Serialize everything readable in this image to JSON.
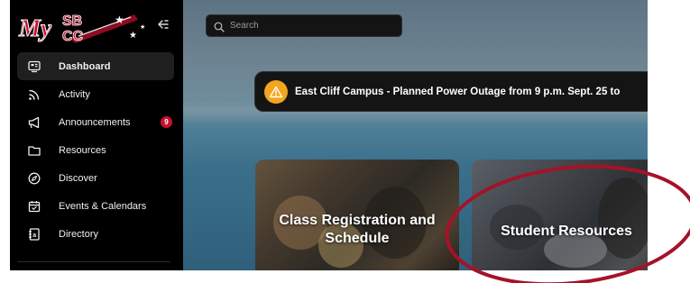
{
  "app": {
    "logo": {
      "line1": "My",
      "line2": "SB",
      "line3": "CC",
      "colors": {
        "text": "#c8102e",
        "outline": "#ffffff"
      }
    },
    "collapse_icon": "collapse-sidebar-icon"
  },
  "sidebar": {
    "items": [
      {
        "label": "Dashboard",
        "icon": "dashboard-icon",
        "active": true
      },
      {
        "label": "Activity",
        "icon": "activity-icon"
      },
      {
        "label": "Announcements",
        "icon": "megaphone-icon",
        "badge": "9"
      },
      {
        "label": "Resources",
        "icon": "folder-icon"
      },
      {
        "label": "Discover",
        "icon": "compass-icon"
      },
      {
        "label": "Events & Calendars",
        "icon": "calendar-icon"
      },
      {
        "label": "Directory",
        "icon": "directory-icon"
      }
    ]
  },
  "search": {
    "placeholder": "Search",
    "value": ""
  },
  "alert": {
    "text": "East Cliff Campus - Planned Power Outage from 9 p.m. Sept. 25 to",
    "icon": "warning-icon"
  },
  "cards": [
    {
      "title": "Class Registration and Schedule"
    },
    {
      "title": "Student Resources"
    }
  ],
  "colors": {
    "accent": "#c8102e",
    "warning": "#f3a51d",
    "highlight_ring": "#a51228"
  }
}
